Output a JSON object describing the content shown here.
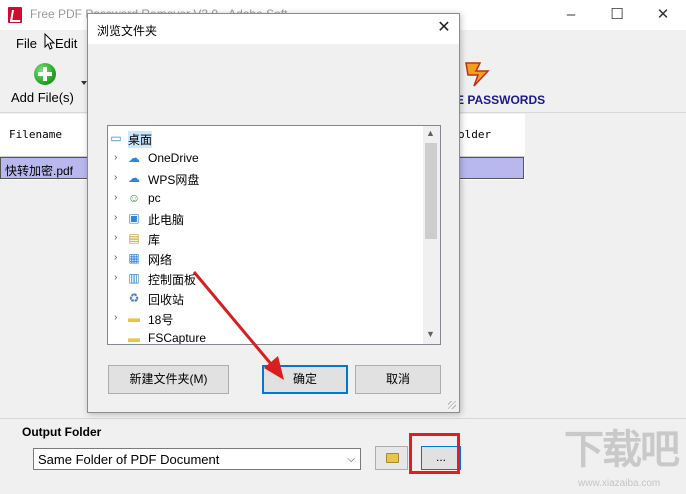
{
  "app": {
    "title": "Free PDF Password Remover V3.0 - Adobe Soft",
    "menu": [
      "File",
      "Edit"
    ],
    "toolbar": {
      "add_label": "Add File(s)",
      "remove_label": "E PASSWORDS"
    },
    "grid": {
      "columns": [
        "Filename",
        "older"
      ],
      "rows": [
        {
          "filename": "快转加密.pdf"
        }
      ]
    },
    "output": {
      "label": "Output Folder",
      "selected": "Same Folder of PDF Document",
      "browse_label": "..."
    },
    "watermark": {
      "large": "下载吧",
      "small": "www.xiazaiba.com"
    }
  },
  "dialog": {
    "title": "浏览文件夹",
    "tree": [
      {
        "label": "桌面",
        "icon": "desktop-icon",
        "expandable": false,
        "selected": true
      },
      {
        "label": "OneDrive",
        "icon": "cloud-icon",
        "expandable": true
      },
      {
        "label": "WPS网盘",
        "icon": "cloud-icon",
        "expandable": true
      },
      {
        "label": "pc",
        "icon": "user-icon",
        "expandable": true
      },
      {
        "label": "此电脑",
        "icon": "computer-icon",
        "expandable": true
      },
      {
        "label": "库",
        "icon": "library-icon",
        "expandable": true
      },
      {
        "label": "网络",
        "icon": "network-icon",
        "expandable": true
      },
      {
        "label": "控制面板",
        "icon": "control-panel-icon",
        "expandable": true
      },
      {
        "label": "回收站",
        "icon": "recycle-bin-icon",
        "expandable": false
      },
      {
        "label": "18号",
        "icon": "folder-icon",
        "expandable": true
      },
      {
        "label": "FSCapture",
        "icon": "folder-icon",
        "expandable": false
      }
    ],
    "buttons": {
      "new_folder": "新建文件夹(M)",
      "ok": "确定",
      "cancel": "取消"
    }
  },
  "colors": {
    "selection": "#cce8ff",
    "grid_row": "#b8b8ee",
    "annotation_red": "#e02020",
    "focus_blue": "#0078d7"
  }
}
